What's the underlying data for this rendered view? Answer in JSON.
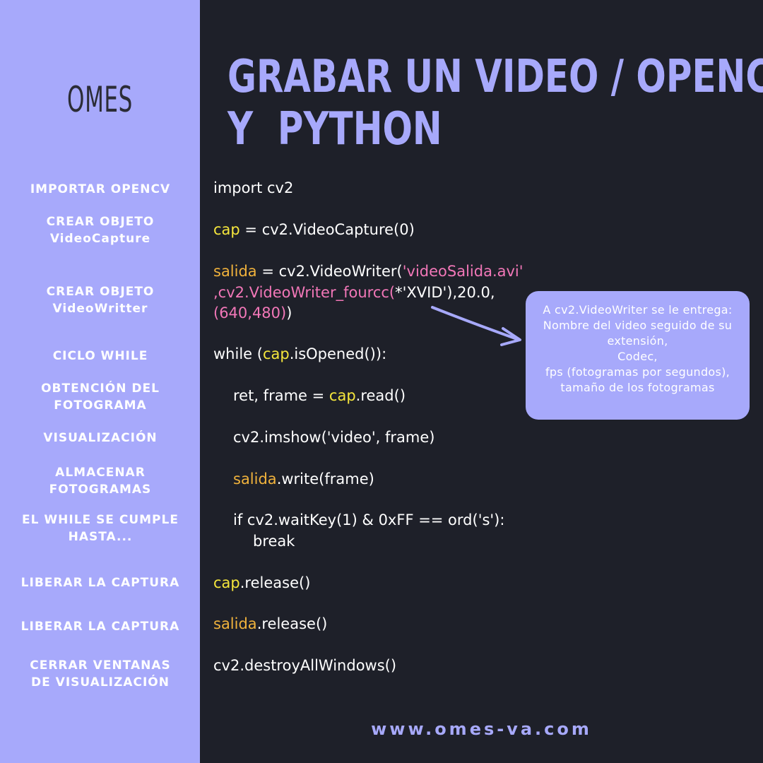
{
  "brand": "OMES",
  "title": "GRABAR UN VIDEO / OPENCV\nY  PYTHON",
  "steps": [
    "IMPORTAR OPENCV",
    "CREAR OBJETO\nVideoCapture",
    "CREAR OBJETO\nVideoWritter",
    "CICLO WHILE",
    "OBTENCIÓN DEL\nFOTOGRAMA",
    "VISUALIZACIÓN",
    "ALMACENAR\nFOTOGRAMAS",
    "EL WHILE SE CUMPLE\nHASTA...",
    "LIBERAR LA CAPTURA",
    "LIBERAR LA CAPTURA",
    "CERRAR VENTANAS\nDE VISUALIZACIÓN"
  ],
  "code": {
    "import": "import cv2",
    "cap_var": "cap",
    "cap_rest": " = cv2.VideoCapture(0)",
    "salida_var": "salida",
    "salida_eq": " = cv2.VideoWriter(",
    "salida_str1": "'videoSalida.avi'",
    "salida_line2": ",cv2.VideoWriter_fourcc(",
    "salida_str2": "*'XVID'",
    "salida_line2_end": "),20.0,",
    "salida_line3": "(640,480)",
    "salida_line3_end": ")",
    "while_a": "while (",
    "while_cap": "cap",
    "while_b": ".isOpened()):",
    "read_a": "ret, frame = ",
    "read_cap": "cap",
    "read_b": ".read()",
    "imshow": "cv2.imshow('video', frame)",
    "write_var": "salida",
    "write_rest": ".write(frame)",
    "waitkey": "if cv2.waitKey(1) & 0xFF == ord('s'):",
    "break": "break",
    "release_cap_var": "cap",
    "release_cap_rest": ".release()",
    "release_sal_var": "salida",
    "release_sal_rest": ".release()",
    "destroy": "cv2.destroyAllWindows()"
  },
  "callout": "A cv2.VideoWriter se le entrega:\nNombre del video seguido de su\nextensión,\nCodec,\nfps (fotogramas por segundos),\ntamaño de los fotogramas",
  "footer": "www.omes-va.com",
  "colors": {
    "sidebar": "#a7a9fb",
    "background": "#1e2029",
    "variable_cap": "#f5e63c",
    "variable_salida": "#f0b23c",
    "string": "#f277b8"
  }
}
